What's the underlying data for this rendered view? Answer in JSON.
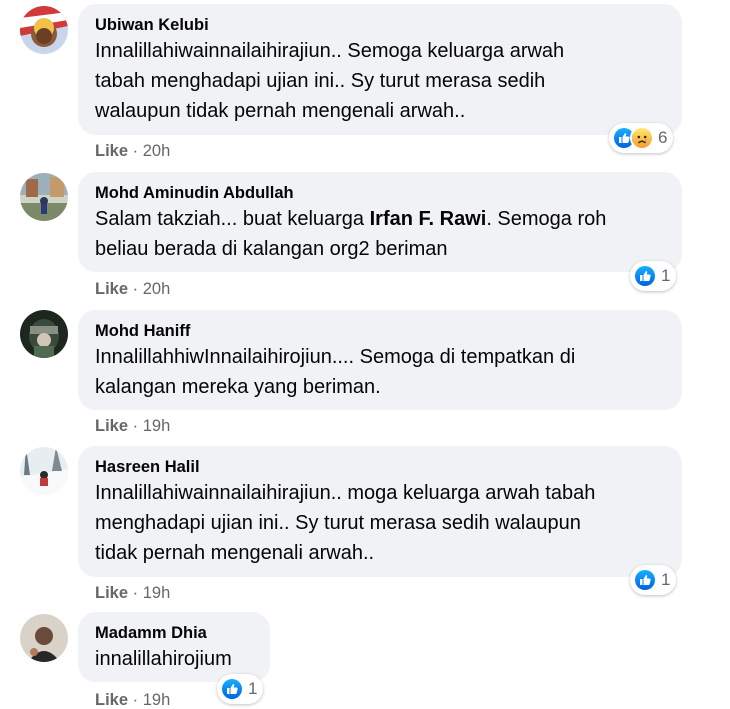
{
  "comments": [
    {
      "author": "Ubiwan Kelubi",
      "lines": [
        "Innalillahiwainnailaihirajiun.. Semoga keluarga arwah",
        "tabah menghadapi ujian ini.. Sy turut merasa sedih",
        "walaupun tidak pernah mengenali arwah.."
      ],
      "like_label": "Like",
      "time": "20h",
      "reactions": [
        "like-icon",
        "sad-icon"
      ],
      "reaction_count": "6"
    },
    {
      "author": "Mohd Aminudin Abdullah",
      "line1_prefix": "Salam takziah... buat keluarga ",
      "mention": "Irfan F. Rawi",
      "line1_suffix": ". Semoga roh",
      "line2": "beliau berada di kalangan org2 beriman",
      "like_label": "Like",
      "time": "20h",
      "reactions": [
        "like-icon"
      ],
      "reaction_count": "1"
    },
    {
      "author": "Mohd Haniff",
      "lines": [
        "InnalillahhiwInnailaihirojiun.... Semoga di tempatkan di",
        "kalangan mereka yang beriman."
      ],
      "like_label": "Like",
      "time": "19h"
    },
    {
      "author": "Hasreen Halil",
      "lines": [
        "Innalillahiwainnailaihirajiun.. moga keluarga arwah tabah",
        "menghadapi ujian ini.. Sy turut merasa sedih walaupun",
        "tidak pernah mengenali arwah.."
      ],
      "like_label": "Like",
      "time": "19h",
      "reactions": [
        "like-icon"
      ],
      "reaction_count": "1"
    },
    {
      "author": "Madamm Dhia",
      "lines": [
        "innalillahirojium"
      ],
      "like_label": "Like",
      "time": "19h",
      "reactions": [
        "like-icon"
      ],
      "reaction_count": "1"
    }
  ],
  "separator": "·",
  "colors": {
    "bubble_bg": "#f0f2f5",
    "like_blue": "#1877f2",
    "meta_grey": "#65676b",
    "sad_yellow": "#f7b125"
  }
}
